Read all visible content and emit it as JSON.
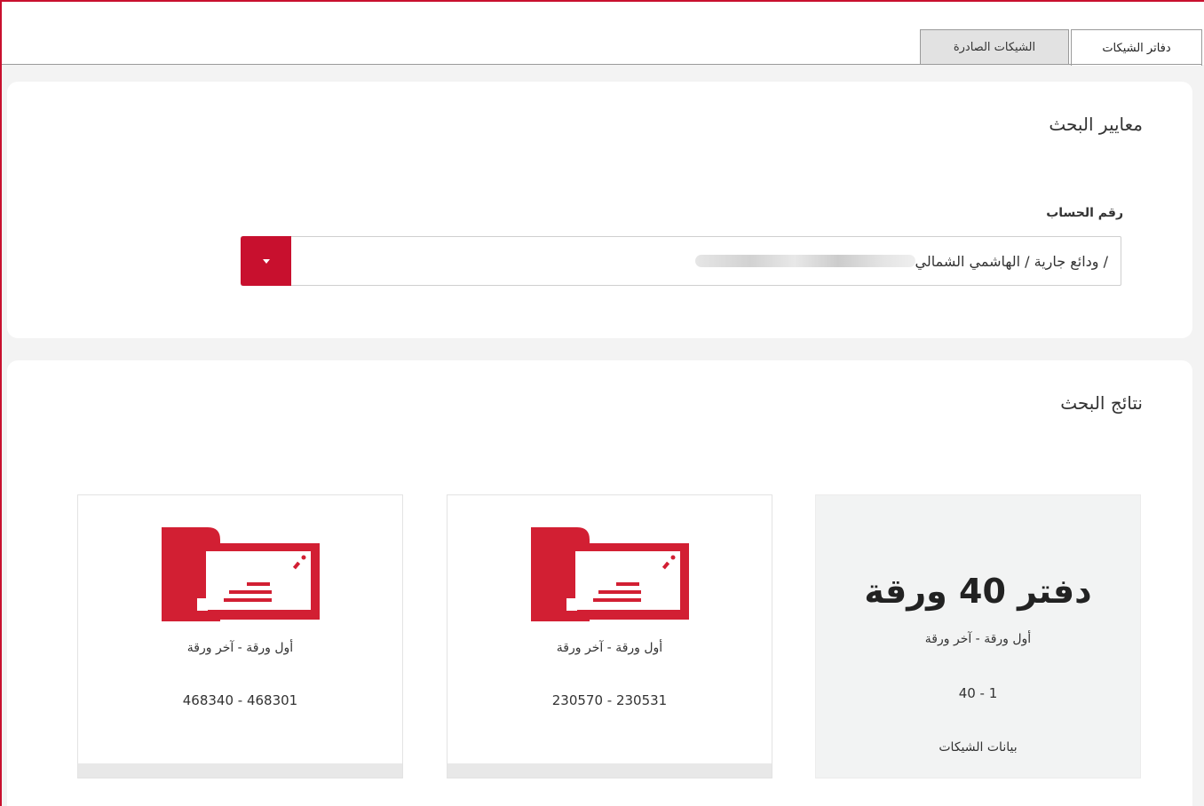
{
  "tabs": {
    "cheque_books": "دفاتر الشيكات",
    "issued_cheques": "الشيكات الصادرة"
  },
  "criteria": {
    "title": "معايير البحث",
    "account_label": "رقم الحساب",
    "account_value": "/ ودائع جارية / الهاشمي الشمالي"
  },
  "results": {
    "title": "نتائج البحث",
    "summary": {
      "heading": "دفتر 40 ورقة",
      "range_label": "أول ورقة - آخر ورقة",
      "range": "40 - 1",
      "details_link": "بيانات الشيكات"
    },
    "books": [
      {
        "range_label": "أول ورقة - آخر ورقة",
        "range": "230570 - 230531",
        "icon": "cheque-book-icon"
      },
      {
        "range_label": "أول ورقة - آخر ورقة",
        "range": "468340 - 468301",
        "icon": "cheque-book-icon"
      }
    ]
  },
  "colors": {
    "accent": "#c8102e",
    "page_background": "#f3f3f3",
    "card_background": "#ffffff"
  }
}
